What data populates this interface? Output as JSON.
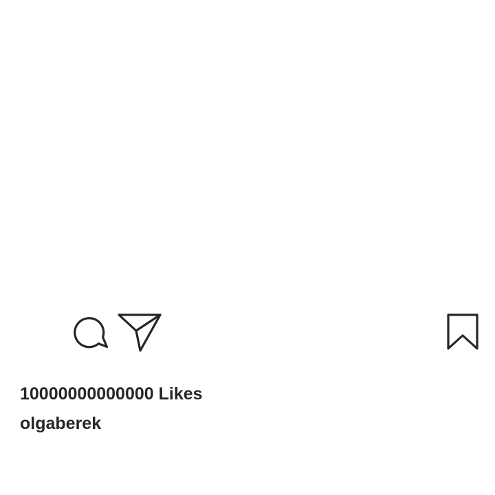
{
  "post": {
    "likes_text": "10000000000000 Likes",
    "username": "olgaberek"
  },
  "actions": {
    "like_icon": "heart-icon",
    "comment_icon": "speech-bubble-icon",
    "share_icon": "paper-plane-icon",
    "save_icon": "bookmark-icon"
  },
  "colors": {
    "icon_stroke": "#262626",
    "text": "#262626",
    "background": "#ffffff"
  }
}
